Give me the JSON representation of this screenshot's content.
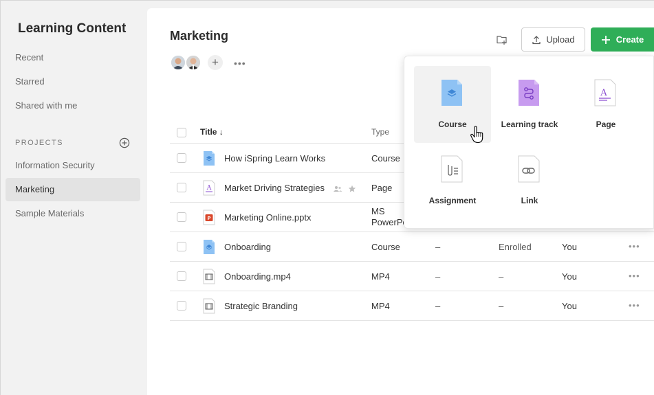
{
  "sidebar": {
    "title": "Learning Content",
    "nav": [
      "Recent",
      "Starred",
      "Shared with me"
    ],
    "section_label": "PROJECTS",
    "projects": [
      "Information Security",
      "Marketing",
      "Sample Materials"
    ],
    "active_project": "Marketing"
  },
  "header": {
    "title": "Marketing",
    "more": "•••",
    "upload_label": "Upload",
    "create_label": "Create"
  },
  "table": {
    "columns": {
      "title": "Title ↓",
      "type": "Type"
    },
    "rows": [
      {
        "title": "How iSpring Learn Works",
        "type": "Course",
        "icon": "course-icon",
        "c3": "",
        "c4": "",
        "c5": ""
      },
      {
        "title": "Market Driving Strategies",
        "type": "Page",
        "icon": "page-icon",
        "c3": "",
        "c4": "",
        "c5": ""
      },
      {
        "title": "Marketing Online.pptx",
        "type": "MS PowerPo",
        "icon": "powerpoint-icon",
        "c3": "",
        "c4": "",
        "c5": ""
      },
      {
        "title": "Onboarding",
        "type": "Course",
        "icon": "course-icon",
        "c3": "–",
        "c4": "Enrolled",
        "c5": "You"
      },
      {
        "title": "Onboarding.mp4",
        "type": "MP4",
        "icon": "video-icon",
        "c3": "–",
        "c4": "–",
        "c5": "You"
      },
      {
        "title": "Strategic Branding",
        "type": "MP4",
        "icon": "video-icon",
        "c3": "–",
        "c4": "–",
        "c5": "You"
      }
    ],
    "row_more": "•••"
  },
  "create_menu": {
    "items": [
      "Course",
      "Learning track",
      "Page",
      "Assignment",
      "Link"
    ]
  },
  "colors": {
    "create_green": "#2fae58",
    "course_blue": "#8ec2f4",
    "track_purple": "#c79bef",
    "page_purple": "#8a4bd0",
    "pptx_red": "#d9472b"
  }
}
